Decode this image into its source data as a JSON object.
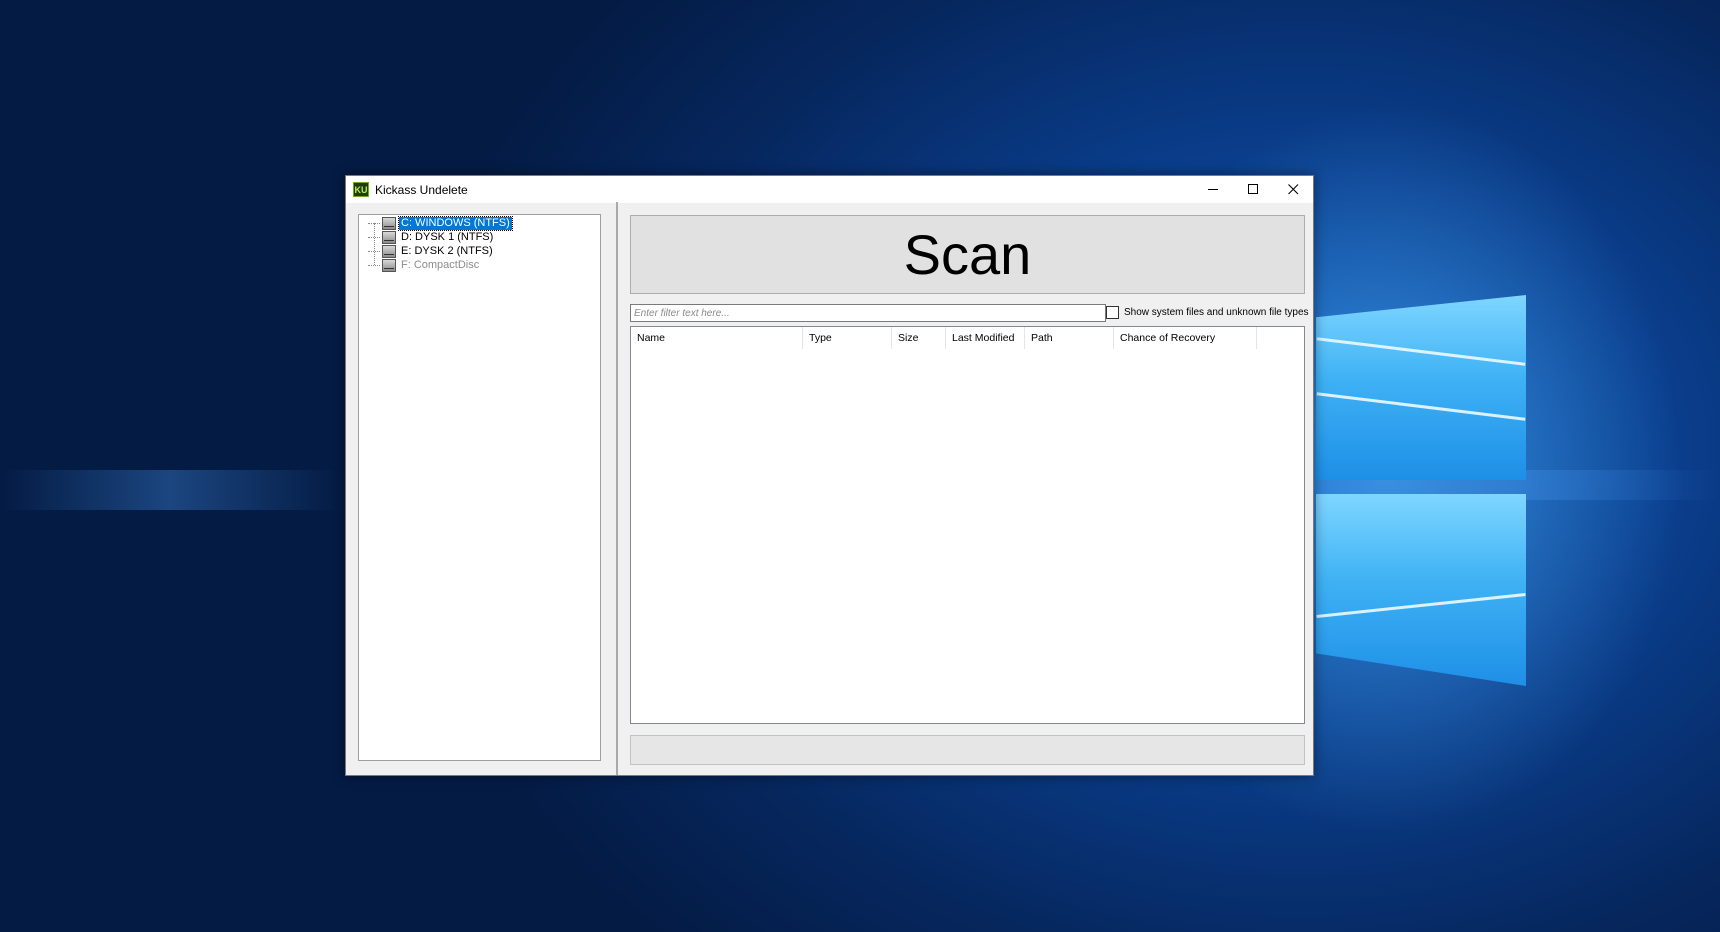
{
  "window": {
    "title": "Kickass Undelete",
    "icon_text": "KU"
  },
  "titlebar_buttons": {
    "minimize_icon": "minimize-icon",
    "maximize_icon": "maximize-icon",
    "close_icon": "close-icon"
  },
  "drives": [
    {
      "label": "C: WINDOWS (NTFS)",
      "selected": true,
      "enabled": true
    },
    {
      "label": "D: DYSK 1 (NTFS)",
      "selected": false,
      "enabled": true
    },
    {
      "label": "E: DYSK 2 (NTFS)",
      "selected": false,
      "enabled": true
    },
    {
      "label": "F: CompactDisc",
      "selected": false,
      "enabled": false
    }
  ],
  "scan_button": {
    "label": "Scan"
  },
  "filter": {
    "placeholder": "Enter filter text here..."
  },
  "show_system_files": {
    "label": "Show system files and unknown file types",
    "checked": false
  },
  "columns": [
    "Name",
    "Type",
    "Size",
    "Last Modified",
    "Path",
    "Chance of Recovery"
  ],
  "colors": {
    "selection": "#0078d7",
    "window_bg": "#f0f0f0",
    "desktop_blue": "#0a3f8f"
  }
}
